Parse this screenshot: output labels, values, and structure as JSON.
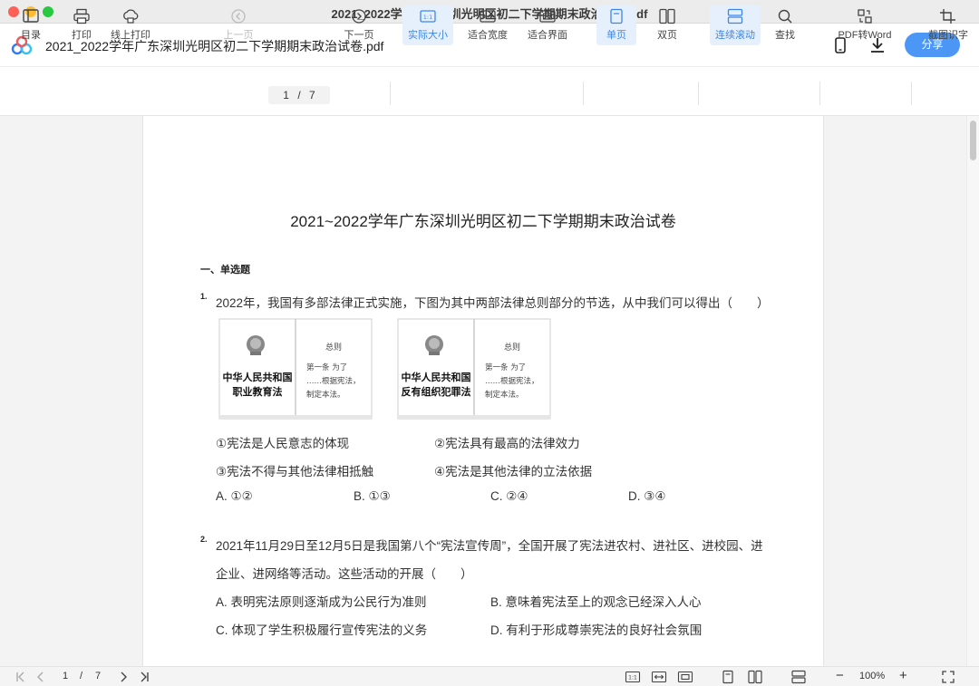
{
  "window": {
    "title": "2021_2022学年广东深圳光明区初二下学期期末政治试卷.pdf"
  },
  "header": {
    "doc_name": "2021_2022学年广东深圳光明区初二下学期期末政治试卷.pdf",
    "share_label": "分享"
  },
  "toolbar": {
    "toc": "目录",
    "print": "打印",
    "online_print": "线上打印",
    "prev_page": "上一页",
    "current_page": "1",
    "page_separator": "/",
    "total_pages": "7",
    "next_page": "下一页",
    "actual_size": "实际大小",
    "fit_width": "适合宽度",
    "fit_page": "适合界面",
    "single_page": "单页",
    "two_page": "双页",
    "continuous_scroll": "连续滚动",
    "find": "查找",
    "pdf_to_word": "PDF转Word",
    "ocr": "截图识字",
    "actual_size_icon_text": "1:1"
  },
  "document": {
    "title": "2021~2022学年广东深圳光明区初二下学期期末政治试卷",
    "section": "一、单选题",
    "q1": {
      "number": "1.",
      "stem": "2022年，我国有多部法律正式实施，下图为其中两部法律总则部分的节选，从中我们可以得出（　　）",
      "images": [
        {
          "cover_title_1": "中华人民共和国",
          "cover_title_2": "职业教育法",
          "section_head": "总则",
          "line1": "第一条 为了",
          "line2": "……根据宪法，",
          "line3": "制定本法。"
        },
        {
          "cover_title_1": "中华人民共和国",
          "cover_title_2": "反有组织犯罪法",
          "section_head": "总则",
          "line1": "第一条 为了",
          "line2": "……根据宪法，",
          "line3": "制定本法。"
        }
      ],
      "statements": [
        "①宪法是人民意志的体现",
        "②宪法具有最高的法律效力",
        "③宪法不得与其他法律相抵触",
        "④宪法是其他法律的立法依据"
      ],
      "options": [
        "A. ①②",
        "B. ①③",
        "C. ②④",
        "D. ③④"
      ]
    },
    "q2": {
      "number": "2.",
      "stem_line1": "2021年11月29日至12月5日是我国第八个“宪法宣传周”，全国开展了宪法进农村、进社区、进校园、进",
      "stem_line2": "企业、进网络等活动。这些活动的开展（　　）",
      "options": [
        "A. 表明宪法原则逐渐成为公民行为准则",
        "B. 意味着宪法至上的观念已经深入人心",
        "C. 体现了学生积极履行宣传宪法的义务",
        "D. 有利于形成尊崇宪法的良好社会氛围"
      ]
    }
  },
  "bottombar": {
    "current_page": "1",
    "separator": "/",
    "total_pages": "7",
    "zoom": "100%",
    "actual_size_icon_text": "1:1",
    "zoom_out": "−",
    "zoom_in": "+"
  },
  "colors": {
    "accent": "#4c97f5",
    "active_bg": "#e6f0fd"
  }
}
